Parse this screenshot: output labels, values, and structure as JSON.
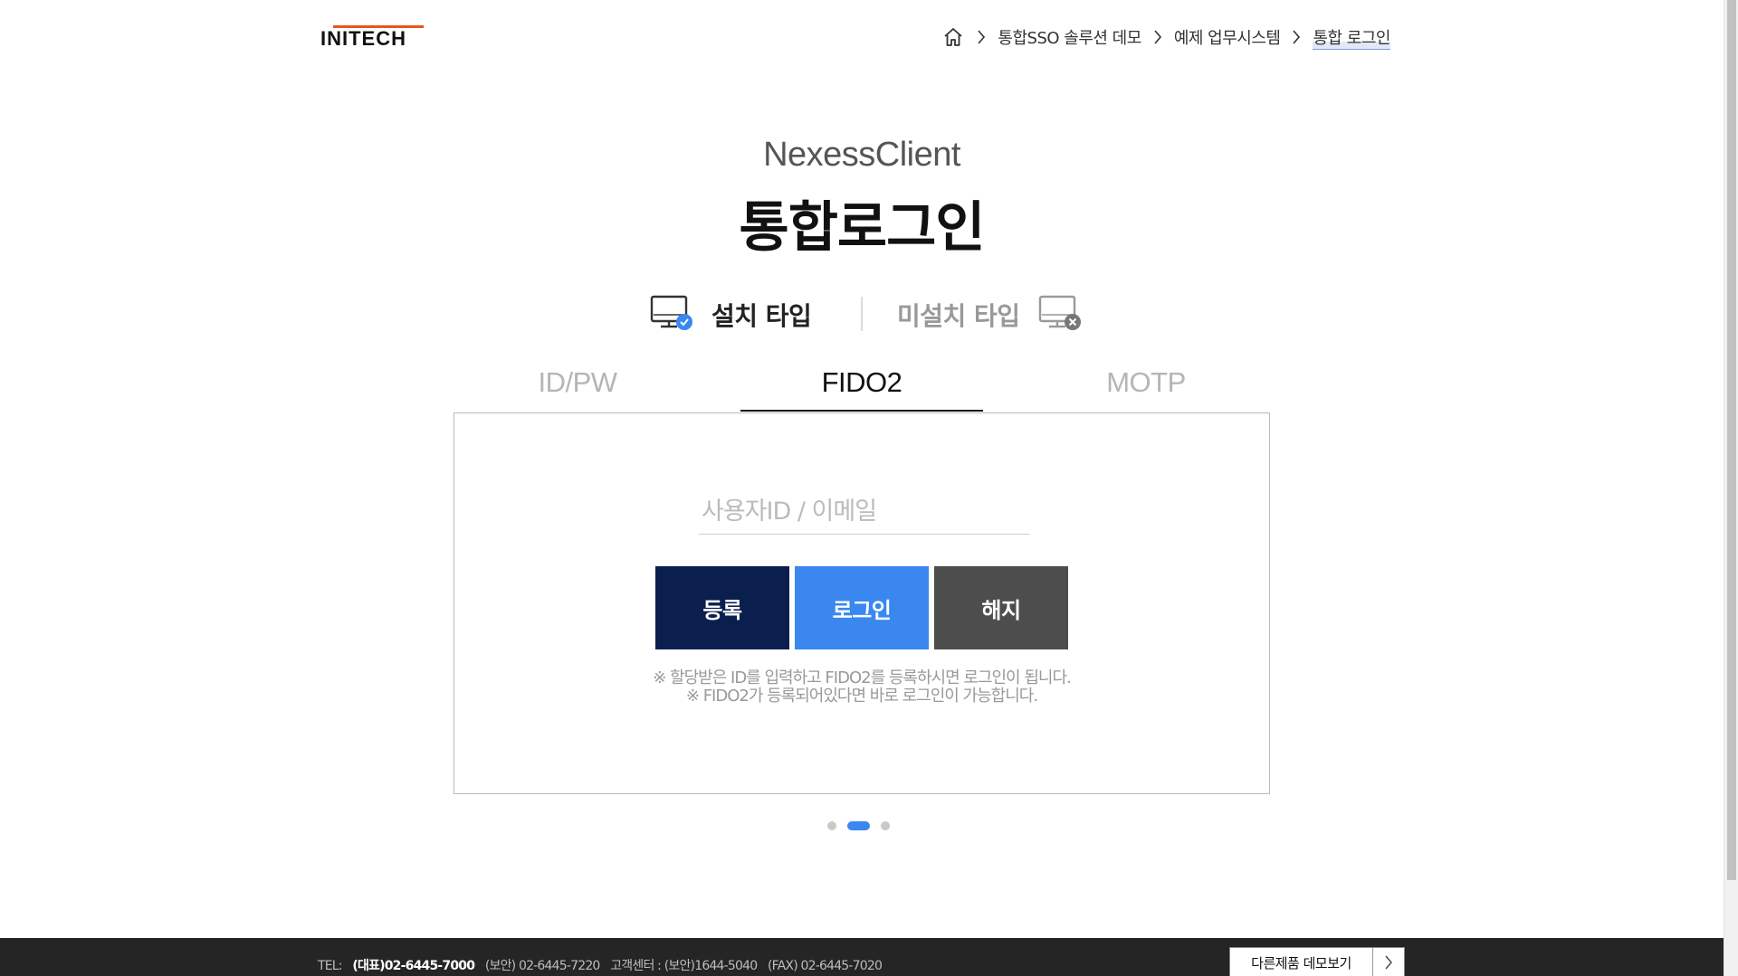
{
  "header": {
    "logo_text": "INITECH",
    "breadcrumb": [
      {
        "label": "통합SSO 솔루션 데모"
      },
      {
        "label": "예제 업무시스템"
      },
      {
        "label": "통합 로그인"
      }
    ]
  },
  "main": {
    "subtitle": "NexessClient",
    "title": "통합로그인",
    "install_types": {
      "installed_label": "설치 타입",
      "uninstalled_label": "미설치 타입",
      "selected": "installed"
    },
    "tabs": [
      {
        "label": "ID/PW",
        "active": false
      },
      {
        "label": "FIDO2",
        "active": true
      },
      {
        "label": "MOTP",
        "active": false
      }
    ],
    "form": {
      "id_placeholder": "사용자ID / 이메일",
      "id_value": "",
      "buttons": {
        "register": "등록",
        "login": "로그인",
        "revoke": "해지"
      },
      "notes": [
        "※ 할당받은 ID를 입력하고 FIDO2를 등록하시면 로그인이 됩니다.",
        "※ FIDO2가 등록되어있다면 바로 로그인이 가능합니다."
      ]
    },
    "pager": {
      "count": 3,
      "active_index": 2
    }
  },
  "footer": {
    "tel_prefix": "TEL:",
    "tel_main": "(대표)02-6445-7000",
    "security": "(보안) 02-6445-7220",
    "support": "고객센터 : (보안)1644-5040",
    "fax": "(FAX) 02-6445-7020",
    "demo_button": "다른제품 데모보기"
  },
  "colors": {
    "register_button": "#0b1f4e",
    "login_button": "#3a87ef",
    "revoke_button": "#4d4d4d",
    "logo_accent": "#e8561f",
    "active_dot": "#3a87ef",
    "footer_bg": "#252525"
  },
  "icons": {
    "home": "home-icon",
    "separator": "chevron-right-icon",
    "installed": "monitor-check-icon",
    "uninstalled": "monitor-x-icon"
  }
}
